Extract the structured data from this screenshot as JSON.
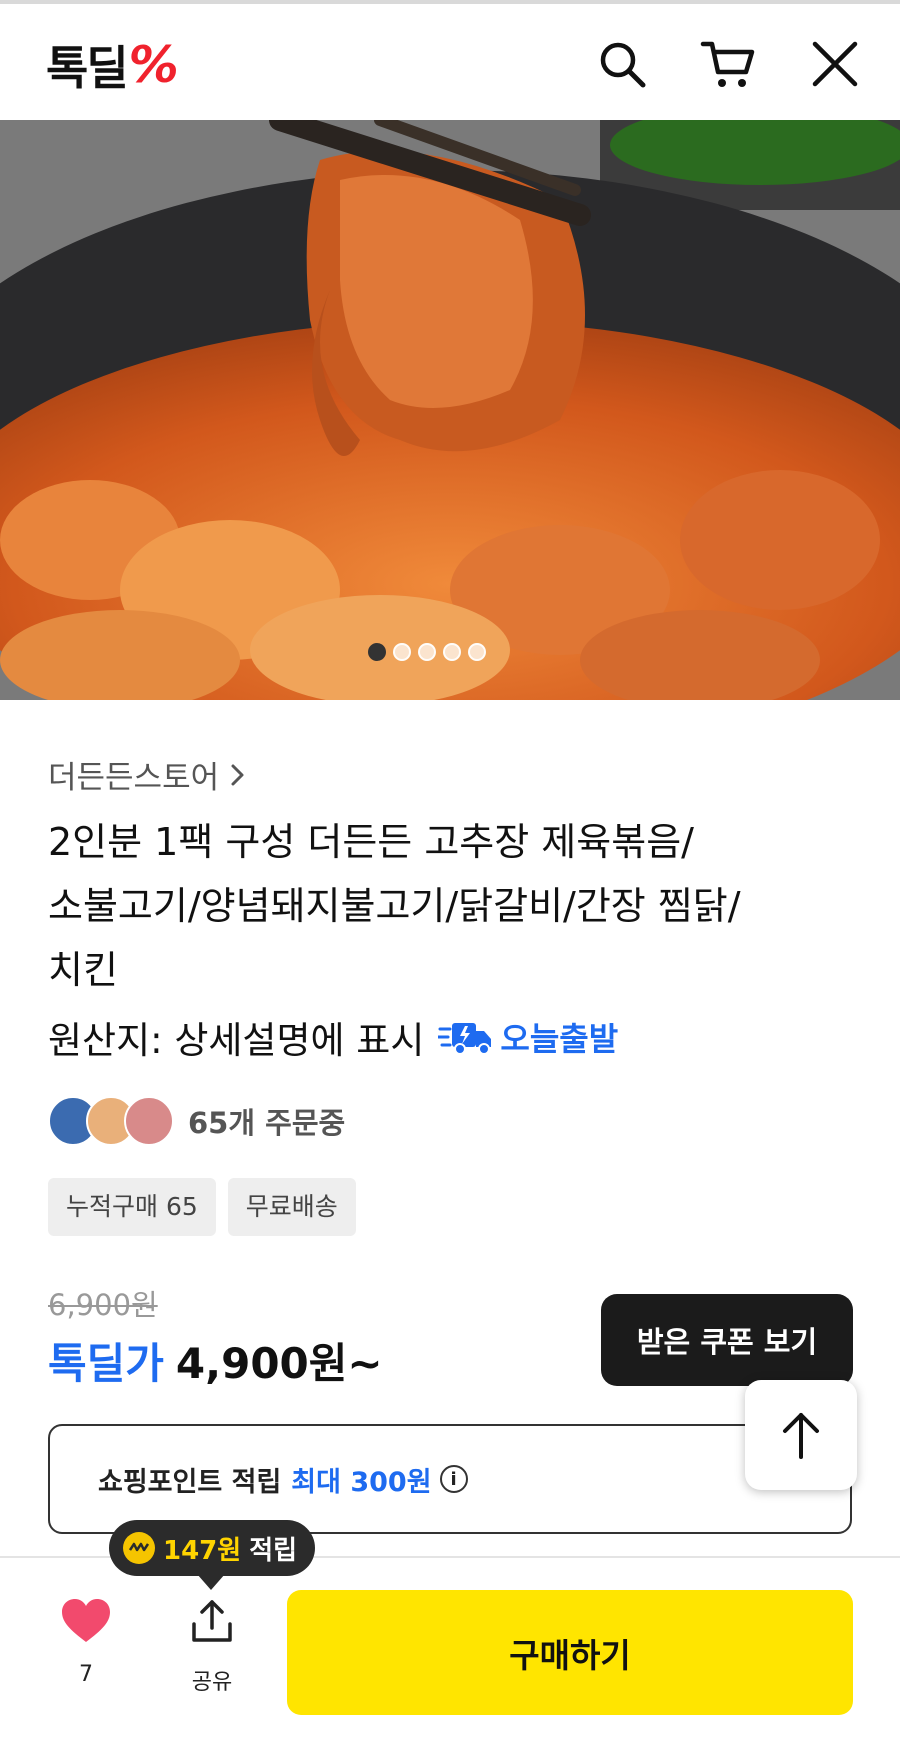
{
  "header": {
    "logo_text": "톡딜",
    "logo_symbol": "%",
    "icons": [
      "search-icon",
      "cart-icon",
      "close-icon"
    ]
  },
  "hero": {
    "image_count": 5,
    "active_index": 0
  },
  "product": {
    "store_name": "더든든스토어",
    "title_lines": [
      "2인분 1팩 구성 더든든 고추장 제육볶음/",
      "소불고기/양념돼지불고기/닭갈비/간장 찜닭/",
      "치킨"
    ],
    "origin": "원산지: 상세설명에 표시",
    "shipping_badge": "오늘출발",
    "orders_text": "65개 주문중",
    "chips": [
      "누적구매 65",
      "무료배송"
    ],
    "original_price": "6,900원",
    "deal_label": "톡딜가",
    "deal_price": "4,900원~",
    "coupon_button": "받은 쿠폰 보기"
  },
  "points": {
    "label": "쇼핑포인트 적립",
    "max_label": "최대 300원"
  },
  "tooltip": {
    "amount": "147원",
    "suffix": "적립"
  },
  "bottom_bar": {
    "like_count": "7",
    "share_label": "공유",
    "buy_label": "구매하기"
  },
  "colors": {
    "brand_red": "#f0222d",
    "accent_blue": "#1e6bf0",
    "buy_yellow": "#ffe500",
    "heart_pink": "#f24a6d"
  }
}
